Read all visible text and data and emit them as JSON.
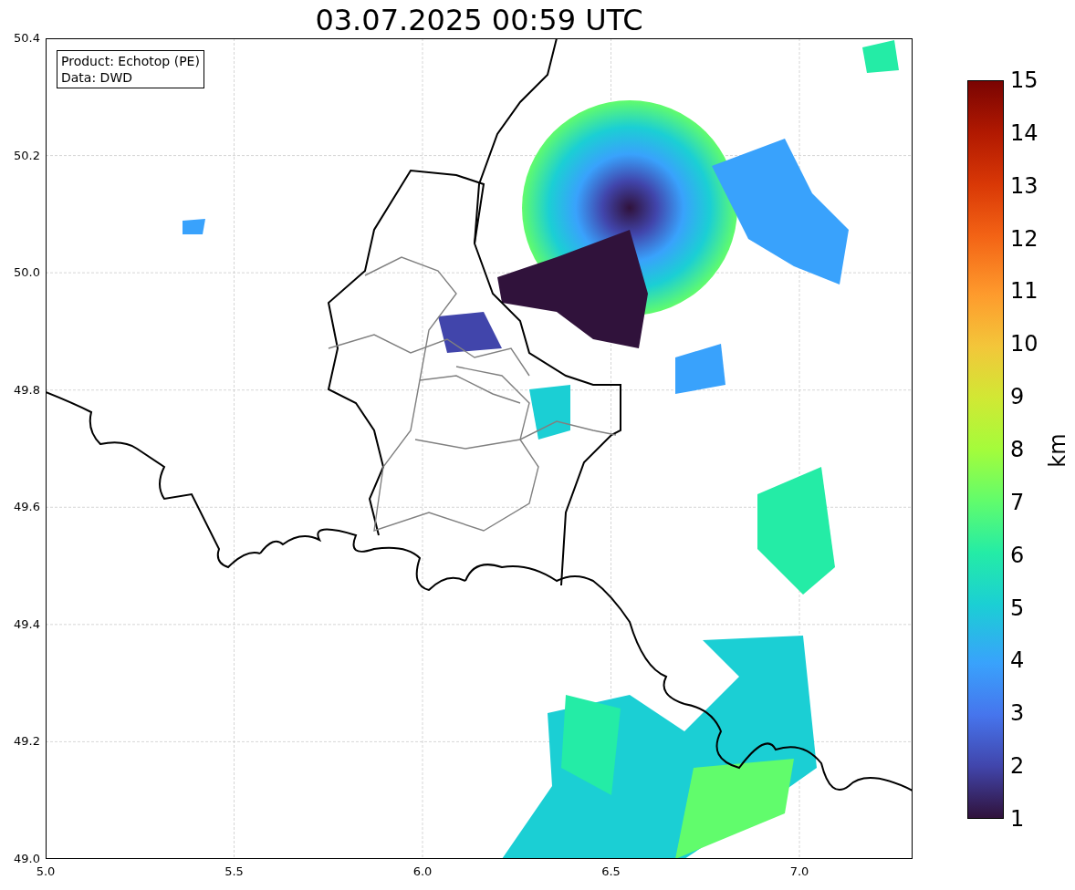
{
  "title": "03.07.2025 00:59 UTC",
  "legend": [
    "Product: Echotop (PE)",
    "Data: DWD"
  ],
  "x_ticks": [
    "5.0",
    "5.5",
    "6.0",
    "6.5",
    "7.0"
  ],
  "y_ticks": [
    "50.4",
    "50.2",
    "50.0",
    "49.8",
    "49.6",
    "49.4",
    "49.2",
    "49.0"
  ],
  "colorbar": {
    "label": "km",
    "ticks": [
      "15",
      "14",
      "13",
      "12",
      "11",
      "10",
      "9",
      "8",
      "7",
      "6",
      "5",
      "4",
      "3",
      "2",
      "1"
    ]
  }
}
